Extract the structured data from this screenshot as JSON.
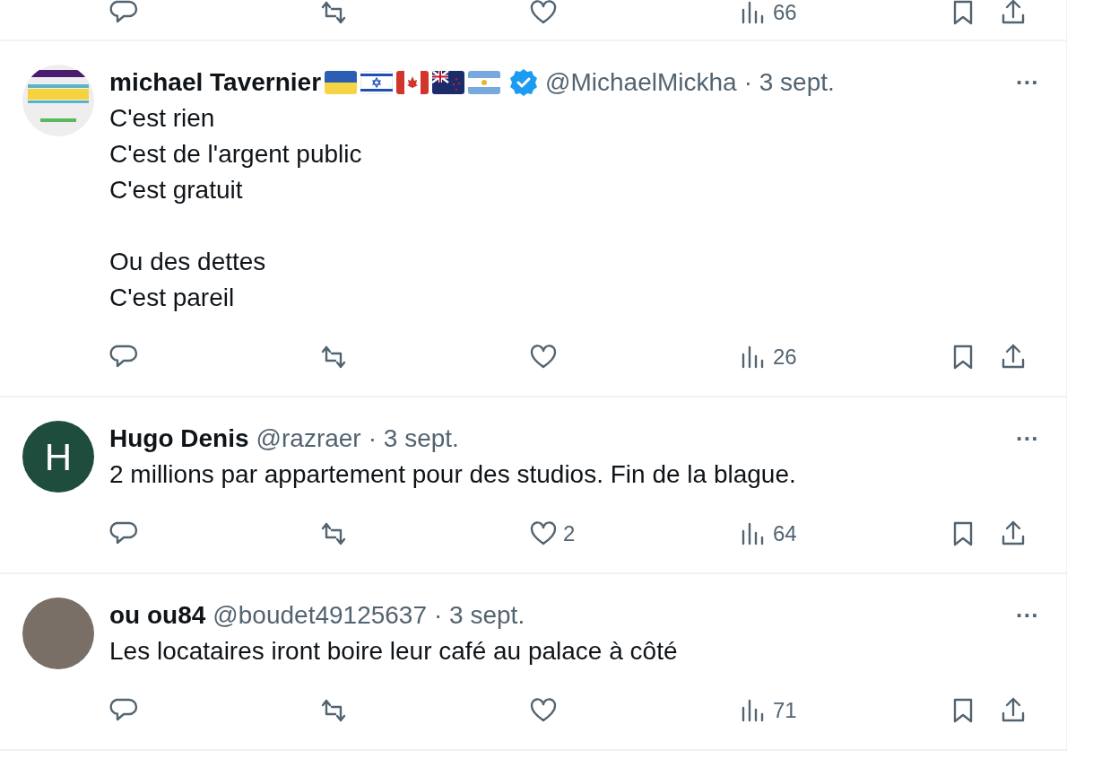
{
  "previous_tweet": {
    "stats": {
      "views": "66"
    }
  },
  "tweets": [
    {
      "name": "michael Tavernier",
      "flags": [
        {
          "kind": "ua"
        },
        {
          "kind": "il"
        },
        {
          "kind": "ca"
        },
        {
          "kind": "nz"
        },
        {
          "kind": "ar"
        }
      ],
      "verified": true,
      "more": "···",
      "handle": "@MichaelMickha",
      "date": "· 3 sept.",
      "avatar": {
        "kind": "banner"
      },
      "paragraphs": [
        "C'est rien\nC'est de l'argent public\nC'est gratuit",
        "Ou des dettes\nC'est pareil"
      ],
      "stats": {
        "views": "26"
      }
    },
    {
      "name": "Hugo Denis",
      "verified": false,
      "more": "···",
      "handle": "@razraer",
      "date": "· 3 sept.",
      "avatar": {
        "kind": "letter",
        "letter": "H",
        "color": "#1f4d3d"
      },
      "paragraphs": [
        "2 millions par appartement pour des studios. Fin de la blague."
      ],
      "stats": {
        "likes": "2",
        "views": "64"
      }
    },
    {
      "name": "ou ou84",
      "verified": false,
      "more": "···",
      "handle": "@boudet49125637",
      "date": "· 3 sept.",
      "avatar": {
        "kind": "photo"
      },
      "paragraphs": [
        "Les locataires iront boire leur café au palace à côté"
      ],
      "stats": {
        "views": "71"
      }
    }
  ]
}
